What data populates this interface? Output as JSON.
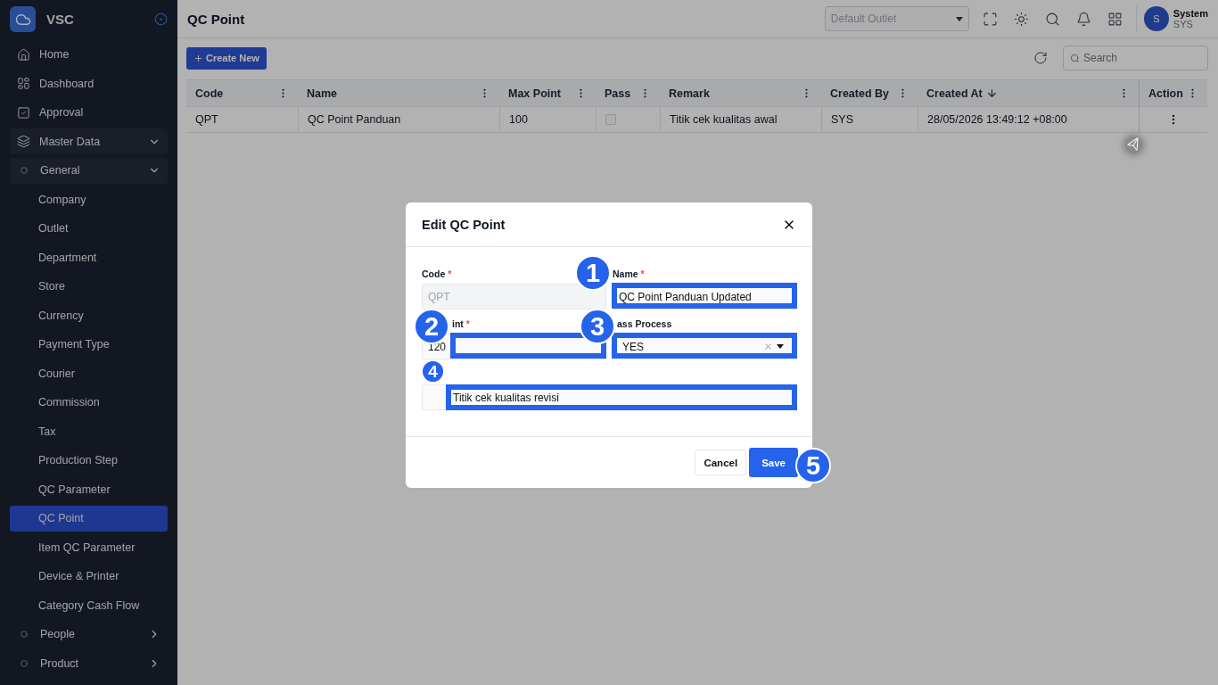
{
  "app": {
    "name": "VSC"
  },
  "sidebar": {
    "items": [
      {
        "label": "Home",
        "kind": "home",
        "selected": false
      },
      {
        "label": "Dashboard",
        "kind": "dashboard",
        "selected": false
      },
      {
        "label": "Approval",
        "kind": "approval",
        "selected": false
      },
      {
        "label": "Master Data",
        "kind": "stack",
        "selected": false,
        "expanded": true,
        "children": [
          {
            "label": "General",
            "kind": "circle",
            "selected": false,
            "expanded": true,
            "children": [
              {
                "label": "Company",
                "selected": false
              },
              {
                "label": "Outlet",
                "selected": false
              },
              {
                "label": "Department",
                "selected": false
              },
              {
                "label": "Store",
                "selected": false
              },
              {
                "label": "Currency",
                "selected": false
              },
              {
                "label": "Payment Type",
                "selected": false
              },
              {
                "label": "Courier",
                "selected": false
              },
              {
                "label": "Commission",
                "selected": false
              },
              {
                "label": "Tax",
                "selected": false
              },
              {
                "label": "Production Step",
                "selected": false
              },
              {
                "label": "QC Parameter",
                "selected": false
              },
              {
                "label": "QC Point",
                "selected": true
              },
              {
                "label": "Item QC Parameter",
                "selected": false
              },
              {
                "label": "Device & Printer",
                "selected": false
              },
              {
                "label": "Category Cash Flow",
                "selected": false
              }
            ]
          },
          {
            "label": "People",
            "kind": "circle",
            "selected": false,
            "expanded": false
          },
          {
            "label": "Product",
            "kind": "circle",
            "selected": false,
            "expanded": false
          }
        ]
      }
    ]
  },
  "topbar": {
    "title": "QC Point",
    "outlet": {
      "placeholder": "Default Outlet"
    },
    "user": {
      "initial": "S",
      "name": "System",
      "code": "SYS"
    }
  },
  "toolbar": {
    "create_button": "Create New",
    "search": {
      "placeholder": "Search"
    }
  },
  "table": {
    "columns": [
      {
        "label": "Code",
        "sorted": false
      },
      {
        "label": "Name",
        "sorted": false
      },
      {
        "label": "Max Point",
        "sorted": false
      },
      {
        "label": "Pass",
        "sorted": false
      },
      {
        "label": "Remark",
        "sorted": false
      },
      {
        "label": "Created By",
        "sorted": false
      },
      {
        "label": "Created At",
        "sorted": true
      },
      {
        "label": "Action",
        "sorted": false
      }
    ],
    "rows": [
      {
        "code": "QPT",
        "name": "QC Point Panduan",
        "max_point": "100",
        "pass": false,
        "remark": "Titik cek kualitas awal",
        "created_by": "SYS",
        "created_at": "28/05/2026 13:49:12 +08:00"
      }
    ]
  },
  "dialog": {
    "title": "Edit QC Point",
    "fields": [
      {
        "kind": "text",
        "label": "Code",
        "mark": "*",
        "value": "QPT",
        "disabled": true
      },
      {
        "kind": "text",
        "label": "Name",
        "mark": "*",
        "value": "QC Point Panduan Updated",
        "disabled": false
      },
      {
        "kind": "text",
        "label": "int",
        "mark": "*",
        "value": "120",
        "disabled": false
      },
      {
        "kind": "select",
        "label": "ass Process",
        "value": "YES"
      },
      {
        "kind": "wide",
        "value": "Titik cek kualitas revisi",
        "disabled": false
      }
    ],
    "buttons": [
      {
        "label": "Cancel",
        "kind": "secondary"
      },
      {
        "label": "Save",
        "kind": "primary"
      }
    ]
  },
  "annotations": [
    "1",
    "2",
    "3",
    "4",
    "5"
  ]
}
